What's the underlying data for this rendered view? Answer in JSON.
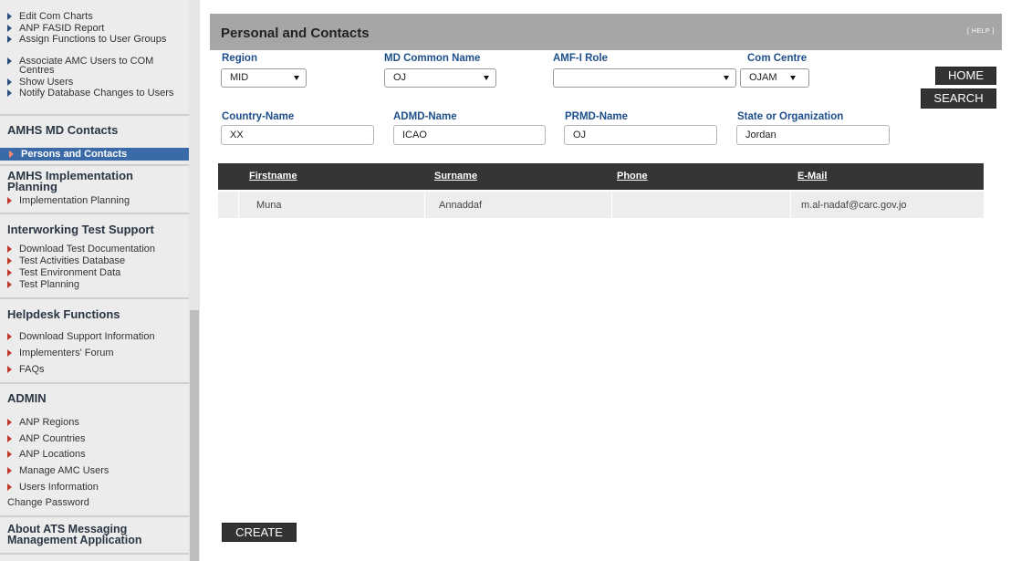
{
  "sidebar": {
    "top_items": [
      "Edit Com Charts",
      "ANP FASID Report",
      "Assign Functions to User Groups",
      "Associate AMC Users to COM Centres",
      "Show Users",
      "Notify Database Changes to Users"
    ],
    "section_amhs_md_contacts": "AMHS MD Contacts",
    "active_item": "Persons and Contacts",
    "section_amhs_impl": "AMHS Implementation Planning",
    "impl_items": [
      "Implementation Planning"
    ],
    "section_interworking": "Interworking Test Support",
    "interworking_items": [
      "Download Test Documentation",
      "Test Activities Database",
      "Test Environment Data",
      "Test Planning"
    ],
    "section_helpdesk": "Helpdesk Functions",
    "helpdesk_items": [
      "Download Support Information",
      "Implementers' Forum",
      "FAQs"
    ],
    "section_admin": "ADMIN",
    "admin_items": [
      "ANP Regions",
      "ANP Countries",
      "ANP Locations",
      "Manage AMC Users",
      "Users Information"
    ],
    "change_password": "Change Password",
    "section_about": "About ATS Messaging Management Application"
  },
  "header": {
    "title": "Personal and Contacts",
    "help": "[ HELP ]"
  },
  "filters": {
    "region_label": "Region",
    "region_value": "MID",
    "md_common_name_label": "MD Common Name",
    "md_common_name_value": "OJ",
    "amf_role_label": "AMF-I Role",
    "amf_role_value": "",
    "com_centre_label": "Com Centre",
    "com_centre_value": "OJAM",
    "country_label": "Country-Name",
    "country_value": "XX",
    "admd_label": "ADMD-Name",
    "admd_value": "ICAO",
    "prmd_label": "PRMD-Name",
    "prmd_value": "OJ",
    "state_label": "State or Organization",
    "state_value": "Jordan"
  },
  "buttons": {
    "home": "HOME",
    "search": "SEARCH",
    "create": "CREATE"
  },
  "table": {
    "headers": [
      "Firstname",
      "Surname",
      "Phone",
      "E-Mail"
    ],
    "rows": [
      [
        "Muna",
        "Annaddaf",
        "",
        "m.al-nadaf@carc.gov.jo"
      ]
    ]
  }
}
